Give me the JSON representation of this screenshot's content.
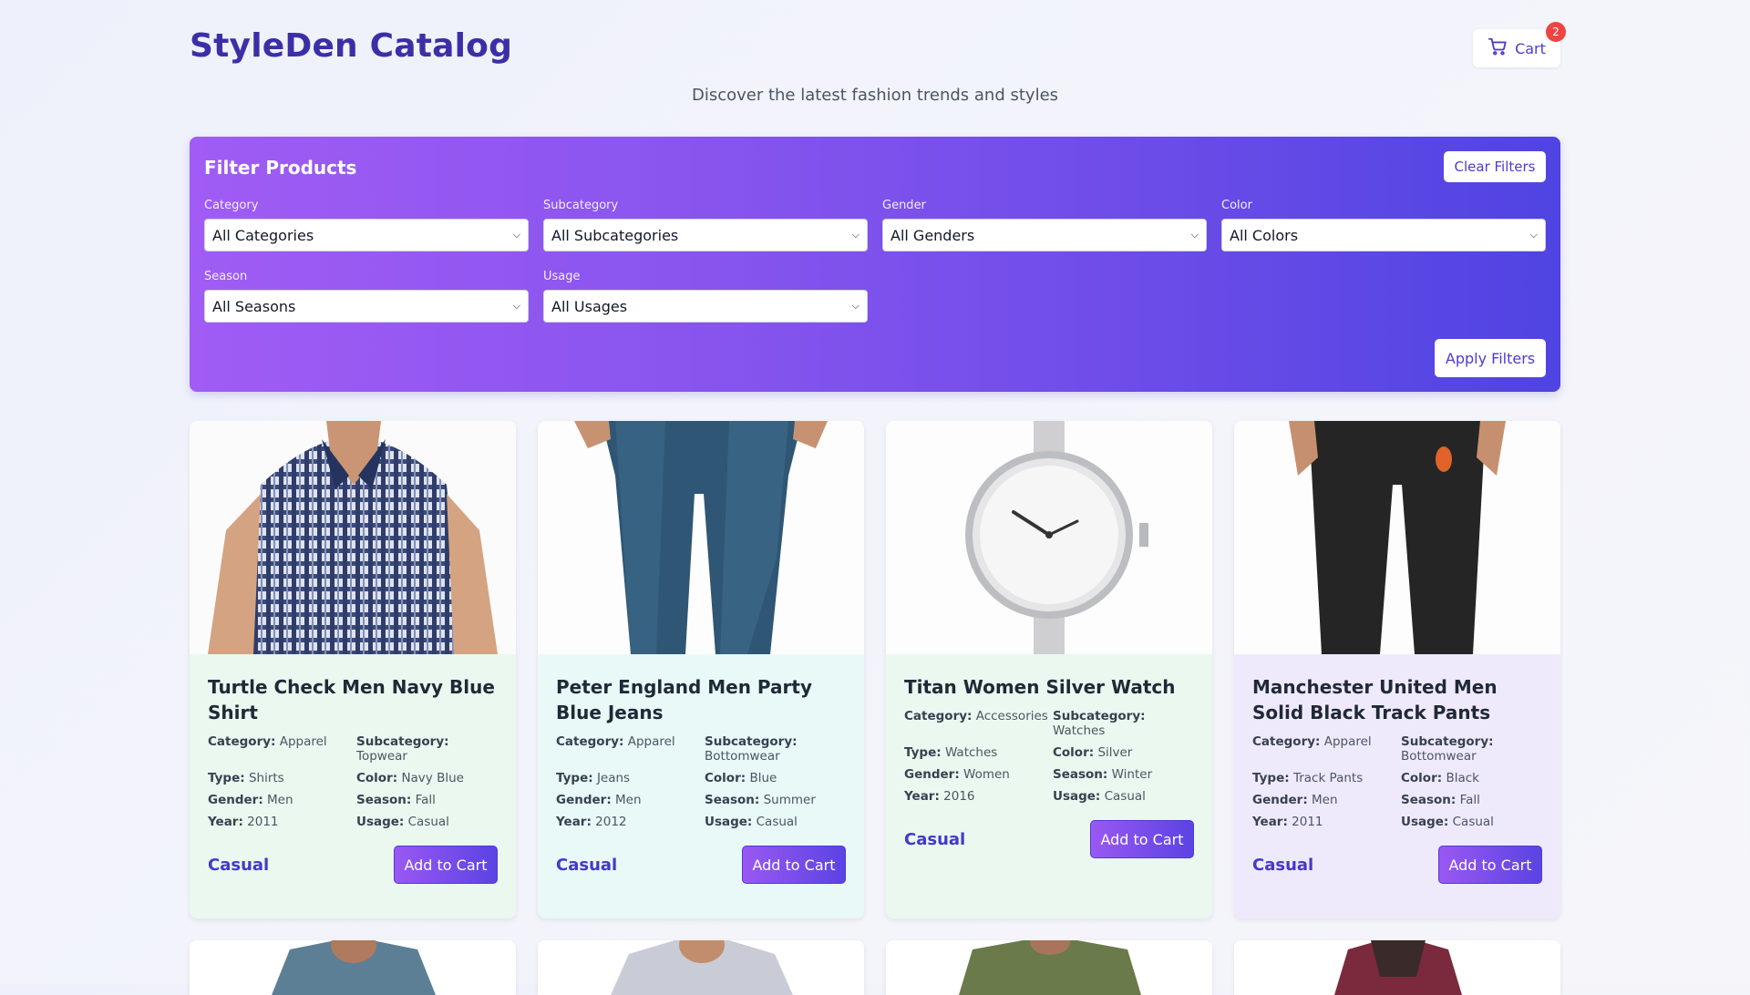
{
  "header": {
    "title": "StyleDen Catalog",
    "subtitle": "Discover the latest fashion trends and styles",
    "cart_label": "Cart",
    "cart_count": "2"
  },
  "filters": {
    "title": "Filter Products",
    "clear_label": "Clear Filters",
    "apply_label": "Apply Filters",
    "fields": [
      {
        "label": "Category",
        "value": "All Categories"
      },
      {
        "label": "Subcategory",
        "value": "All Subcategories"
      },
      {
        "label": "Gender",
        "value": "All Genders"
      },
      {
        "label": "Color",
        "value": "All Colors"
      },
      {
        "label": "Season",
        "value": "All Seasons"
      },
      {
        "label": "Usage",
        "value": "All Usages"
      }
    ]
  },
  "labels": {
    "category": "Category:",
    "subcategory": "Subcategory:",
    "type": "Type:",
    "color": "Color:",
    "gender": "Gender:",
    "season": "Season:",
    "year": "Year:",
    "usage": "Usage:",
    "add_to_cart": "Add to Cart"
  },
  "products": [
    {
      "name": "Turtle Check Men Navy Blue Shirt",
      "category": "Apparel",
      "subcategory": "Topwear",
      "type": "Shirts",
      "color": "Navy Blue",
      "gender": "Men",
      "season": "Fall",
      "year": "2011",
      "usage": "Casual",
      "tag": "Casual",
      "bg": "#eaf8ef"
    },
    {
      "name": "Peter England Men Party Blue Jeans",
      "category": "Apparel",
      "subcategory": "Bottomwear",
      "type": "Jeans",
      "color": "Blue",
      "gender": "Men",
      "season": "Summer",
      "year": "2012",
      "usage": "Casual",
      "tag": "Casual",
      "bg": "#e8f9f7"
    },
    {
      "name": "Titan Women Silver Watch",
      "category": "Accessories",
      "subcategory": "Watches",
      "type": "Watches",
      "color": "Silver",
      "gender": "Women",
      "season": "Winter",
      "year": "2016",
      "usage": "Casual",
      "tag": "Casual",
      "bg": "#eaf8ef"
    },
    {
      "name": "Manchester United Men Solid Black Track Pants",
      "category": "Apparel",
      "subcategory": "Bottomwear",
      "type": "Track Pants",
      "color": "Black",
      "gender": "Men",
      "season": "Fall",
      "year": "2011",
      "usage": "Casual",
      "tag": "Casual",
      "bg": "#efeafb"
    }
  ]
}
